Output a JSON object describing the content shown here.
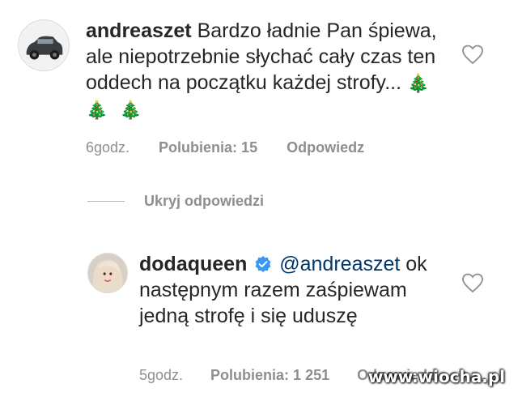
{
  "comment": {
    "username": "andreaszet",
    "text": "Bardzo ładnie Pan śpiewa, ale niepotrzebnie słychać cały czas ten oddech na początku każdej strofy...",
    "emoji": "🎄 🎄 🎄",
    "time": "6godz.",
    "likes": "Polubienia: 15",
    "reply": "Odpowiedz"
  },
  "hide_replies": "Ukryj odpowiedzi",
  "reply": {
    "username": "dodaqueen",
    "mention": "@andreaszet",
    "text": "ok następnym razem zaśpiewam jedną strofę i się uduszę",
    "time": "5godz.",
    "likes": "Polubienia: 1 251",
    "reply": "Odpowiedz"
  },
  "watermark": "www.wiocha.pl",
  "icons": {
    "comment_like": "heart-outline-icon",
    "reply_like": "heart-outline-icon",
    "verified": "verified-badge-icon"
  },
  "colors": {
    "text": "#262626",
    "secondary": "#8e8e8e",
    "verified": "#3897f0"
  }
}
